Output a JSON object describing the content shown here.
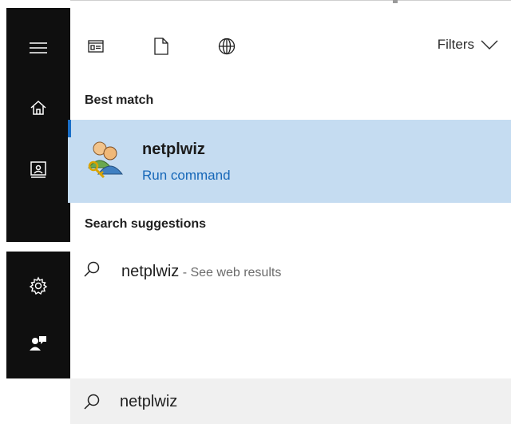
{
  "toolbar": {
    "icons": [
      "apps-icon",
      "documents-icon",
      "web-icon"
    ],
    "filters_label": "Filters"
  },
  "sections": {
    "best_match": "Best match",
    "search_suggestions": "Search suggestions"
  },
  "best_match": {
    "title": "netplwiz",
    "subtitle": "Run command",
    "icon": "user-accounts-icon"
  },
  "suggestion": {
    "term": "netplwiz",
    "hint": " - See web results"
  },
  "search": {
    "value": "netplwiz"
  },
  "rail": {
    "items": [
      "hamburger-menu-icon",
      "home-icon",
      "notebook-icon",
      "settings-icon",
      "feedback-icon"
    ]
  },
  "colors": {
    "rail_bg": "#0f0f0f",
    "highlight_bg": "#c5dcf1",
    "accent": "#1667b8",
    "search_bg": "#f0f0f0"
  }
}
